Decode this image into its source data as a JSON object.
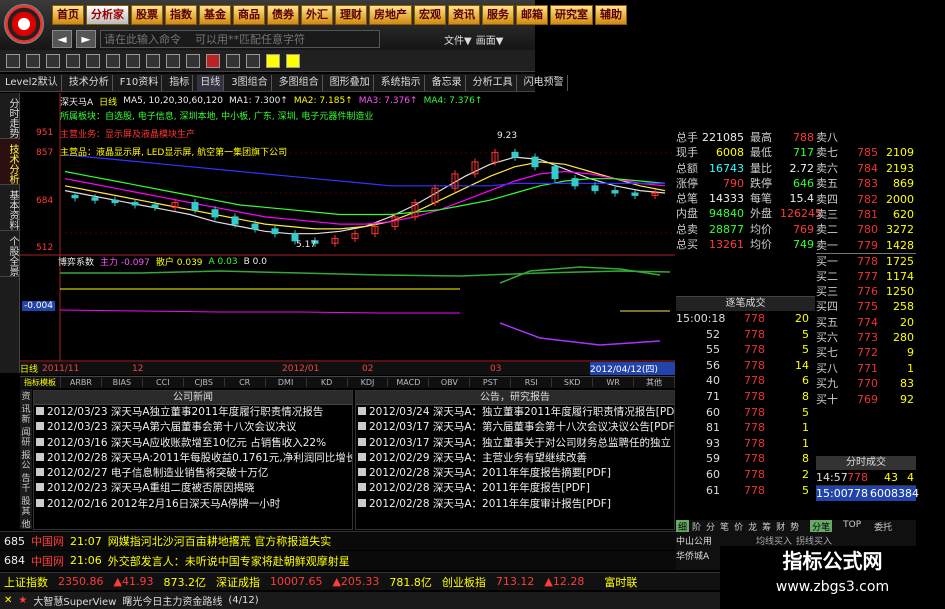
{
  "menu": [
    "首页",
    "分析家",
    "股票",
    "指数",
    "基金",
    "商品",
    "债券",
    "外汇",
    "理财",
    "房地产",
    "宏观",
    "资讯",
    "服务",
    "邮箱",
    "研究室",
    "辅助"
  ],
  "cmd": {
    "placeholder": "请在此输入命令    可以用**匹配任意字符",
    "file": "文件▼",
    "view": "画面▼"
  },
  "toolbar2": [
    "Level2默认",
    "技术分析",
    "F10资料",
    "指标",
    "日线",
    "3图组合",
    "多图组合",
    "图形叠加",
    "系统指示",
    "备忘录",
    "分析工具",
    "闪电预警"
  ],
  "vtabs": [
    "分时走势",
    "技术分析",
    "基本资料",
    "个股全景"
  ],
  "chart": {
    "stock": "深天马A",
    "period": "日线",
    "ma_line": "MA5, 10,20,30,60,120",
    "ma1": "MA1: 7.300↑",
    "ma2": "MA2: 7.185↑",
    "ma3": "MA3: 7.376↑",
    "ma4": "MA4: 7.376↑",
    "price_labels": [
      "951",
      "857",
      "684",
      "512"
    ],
    "notes": [
      {
        "label": "所属板块：自选股, 电子信息, 深圳本地, 中小板, 广东, 深圳, 电子元器件制造业",
        "color": "#3f3"
      },
      {
        "label": "主营业务：显示屏及液晶模块生产",
        "color": "#f33"
      },
      {
        "label": "主营品：液晶显示屏, LED显示屏, 航空第一集团旗下公司",
        "color": "#ff0"
      }
    ],
    "peak_label": "9.23",
    "low_label": "5.17",
    "indicator": {
      "name": "博弈系数",
      "main": "主力 -0.097",
      "retail": "散户 0.039",
      "a": "A 0.03",
      "b": "B 0.0"
    },
    "indicator_value": "-0.004",
    "x_labels": [
      "2011/11",
      "12",
      "2012/01",
      "02",
      "03",
      "2012/04/12(四)"
    ],
    "period_tab": "日线"
  },
  "chart_data": {
    "type": "candlestick",
    "title": "深天马A",
    "x": [
      "2011/11",
      "12",
      "2012/01",
      "02",
      "03",
      "2012/04"
    ],
    "ylim": [
      5.0,
      9.6
    ],
    "closes": [
      7.1,
      7.0,
      6.9,
      6.8,
      6.7,
      6.9,
      6.6,
      6.3,
      6.0,
      5.8,
      5.6,
      5.3,
      5.2,
      5.4,
      5.6,
      5.9,
      6.3,
      6.9,
      7.5,
      8.1,
      8.6,
      9.0,
      8.8,
      8.4,
      7.9,
      7.6,
      7.4,
      7.3,
      7.2,
      7.3
    ],
    "ma_series": [
      {
        "name": "MA1",
        "color": "#e0e0e0",
        "values": [
          7.4,
          7.2,
          7.0,
          6.8,
          6.6,
          6.4,
          6.1,
          5.9,
          5.7,
          5.6,
          5.6,
          5.7,
          5.9,
          6.3,
          6.8,
          7.4,
          8.0,
          8.5,
          8.8,
          8.7,
          8.3,
          7.9,
          7.6,
          7.4,
          7.3
        ]
      },
      {
        "name": "MA2",
        "color": "#ffea3a",
        "values": [
          7.6,
          7.4,
          7.2,
          7.0,
          6.8,
          6.6,
          6.4,
          6.2,
          6.0,
          5.9,
          5.8,
          5.8,
          5.9,
          6.1,
          6.5,
          7.0,
          7.5,
          8.0,
          8.4,
          8.6,
          8.5,
          8.2,
          7.9,
          7.6,
          7.4
        ]
      },
      {
        "name": "MA3",
        "color": "#f0f",
        "values": [
          7.9,
          7.7,
          7.5,
          7.3,
          7.1,
          6.9,
          6.7,
          6.5,
          6.3,
          6.2,
          6.1,
          6.0,
          6.0,
          6.1,
          6.3,
          6.6,
          7.0,
          7.4,
          7.8,
          8.1,
          8.2,
          8.1,
          7.9,
          7.7,
          7.6
        ]
      },
      {
        "name": "MA4",
        "color": "#3f3",
        "values": [
          8.2,
          8.0,
          7.8,
          7.6,
          7.4,
          7.2,
          7.0,
          6.8,
          6.7,
          6.6,
          6.5,
          6.4,
          6.4,
          6.4,
          6.5,
          6.6,
          6.8,
          7.0,
          7.3,
          7.6,
          7.8,
          7.9,
          7.9,
          7.8,
          7.7
        ]
      },
      {
        "name": "MA5",
        "color": "#33f",
        "values": [
          8.9,
          8.8,
          8.7,
          8.6,
          8.5,
          8.4,
          8.3,
          8.2,
          8.1,
          8.0,
          7.9,
          7.8,
          7.7,
          7.6,
          7.6,
          7.6,
          7.6,
          7.6,
          7.7,
          7.7,
          7.7,
          7.7,
          7.7,
          7.7,
          7.7
        ]
      }
    ]
  },
  "indicator_tabs": [
    "指标模板",
    "ARBR",
    "BIAS",
    "CCI",
    "CJBS",
    "CR",
    "DMI",
    "KD",
    "KDJ",
    "MACD",
    "OBV",
    "PST",
    "RSI",
    "SKD",
    "WR",
    "其他"
  ],
  "news_vtabs": [
    "资讯",
    "新闻",
    "研报",
    "公告",
    "千股",
    "其他"
  ],
  "news_left": {
    "title": "公司新闻",
    "rows": [
      "2012/03/23  深天马A独立董事2011年度履行职责情况报告",
      "2012/03/23  深天马A第六届董事会第十八次会议决议",
      "2012/03/16  深天马A应收账款增至10亿元 占销售收入22%",
      "2012/02/28  深天马A:2011年每股收益0.1761元,净利润同比增长43.",
      "2012/02/27  电子信息制造业销售将突破十万亿",
      "2012/02/23  深天马A重组二度被否原因揭晓",
      "2012/02/16  2012年2月16日深天马A停牌一小时"
    ]
  },
  "news_right": {
    "title": "公告，研究报告",
    "rows": [
      "2012/03/24  深天马A：独立董事2011年度履行职责情况报告[PDF]",
      "2012/03/17  深天马A：第六届董事会第十八次会议决议公告[PDF]",
      "2012/03/17  深天马A：独立董事关于对公司财务总监聘任的独立",
      "2012/02/29  深天马A：主营业务有望继续改善",
      "2012/02/28  深天马A：2011年年度报告摘要[PDF]",
      "2012/02/28  深天马A：2011年年度报告[PDF]",
      "2012/02/28  深天马A：2011年年度审计报告[PDF]"
    ]
  },
  "quote": [
    {
      "l1": "总手",
      "v1": "221085",
      "c1": "wht",
      "l2": "最高",
      "v2": "788",
      "c2": "red"
    },
    {
      "l1": "现手",
      "v1": "6008",
      "c1": "yel",
      "l2": "最低",
      "v2": "717",
      "c2": "grn"
    },
    {
      "l1": "总额",
      "v1": "16743",
      "c1": "cyn",
      "l2": "量比",
      "v2": "2.72",
      "c2": "wht"
    },
    {
      "l1": "涨停",
      "v1": "790",
      "c1": "red",
      "l2": "跌停",
      "v2": "646",
      "c2": "grn"
    },
    {
      "l1": "总笔",
      "v1": "14333",
      "c1": "wht",
      "l2": "每笔",
      "v2": "15.4",
      "c2": "wht"
    },
    {
      "l1": "内盘",
      "v1": "94840",
      "c1": "grn",
      "l2": "外盘",
      "v2": "126245",
      "c2": "red"
    },
    {
      "l1": "总卖",
      "v1": "28877",
      "c1": "grn",
      "l2": "均价",
      "v2": "769",
      "c2": "red"
    },
    {
      "l1": "总买",
      "v1": "13261",
      "c1": "red",
      "l2": "均价",
      "v2": "749",
      "c2": "grn"
    }
  ],
  "orders": [
    {
      "l": "卖八",
      "p": "",
      "q": ""
    },
    {
      "l": "卖七",
      "p": "785",
      "q": "2109"
    },
    {
      "l": "卖六",
      "p": "784",
      "q": "2193"
    },
    {
      "l": "卖五",
      "p": "783",
      "q": "869"
    },
    {
      "l": "卖四",
      "p": "782",
      "q": "2000"
    },
    {
      "l": "卖三",
      "p": "781",
      "q": "620"
    },
    {
      "l": "卖二",
      "p": "780",
      "q": "3272"
    },
    {
      "l": "卖一",
      "p": "779",
      "q": "1428"
    },
    {
      "l": "买一",
      "p": "778",
      "q": "1725"
    },
    {
      "l": "买二",
      "p": "777",
      "q": "1174"
    },
    {
      "l": "买三",
      "p": "776",
      "q": "1250"
    },
    {
      "l": "买四",
      "p": "775",
      "q": "258"
    },
    {
      "l": "买五",
      "p": "774",
      "q": "20"
    },
    {
      "l": "买六",
      "p": "773",
      "q": "280"
    },
    {
      "l": "买七",
      "p": "772",
      "q": "9"
    },
    {
      "l": "买八",
      "p": "771",
      "q": "1"
    },
    {
      "l": "买九",
      "p": "770",
      "q": "83"
    },
    {
      "l": "买十",
      "p": "769",
      "q": "92"
    }
  ],
  "ticks": {
    "title": "逐笔成交",
    "rows": [
      {
        "t": "15:00:18",
        "p": "778",
        "v": "20"
      },
      {
        "t": "52",
        "p": "778",
        "v": "5"
      },
      {
        "t": "55",
        "p": "778",
        "v": "5"
      },
      {
        "t": "56",
        "p": "778",
        "v": "14"
      },
      {
        "t": "40",
        "p": "778",
        "v": "6"
      },
      {
        "t": "71",
        "p": "778",
        "v": "8"
      },
      {
        "t": "60",
        "p": "778",
        "v": "5"
      },
      {
        "t": "81",
        "p": "778",
        "v": "1"
      },
      {
        "t": "93",
        "p": "778",
        "v": "1"
      },
      {
        "t": "59",
        "p": "778",
        "v": "8"
      },
      {
        "t": "60",
        "p": "778",
        "v": "2"
      },
      {
        "t": "61",
        "p": "778",
        "v": "5"
      }
    ]
  },
  "fenshi": {
    "title": "分时成交",
    "r1": {
      "t": "14:57",
      "p": "778",
      "a": "43",
      "b": "4"
    },
    "r2": {
      "t": "15:00",
      "p": "778",
      "a": "6008",
      "b": "384"
    }
  },
  "rbot_tabs": [
    "细",
    "阶",
    "分",
    "笔",
    "价",
    "龙",
    "筹",
    "财",
    "势"
  ],
  "rbot_tabs2": [
    "分笔",
    "TOP",
    "委托"
  ],
  "rbot": {
    "l1": "中山公用",
    "l2": "华侨城A",
    "l3": "均线买入",
    "l4": "拐线买入"
  },
  "bar1": {
    "code": "685",
    "name": "中国网",
    "time": "21:07",
    "text": "网媒指河北沙河百亩耕地撂荒 官方称报道失实"
  },
  "bar2": {
    "code": "684",
    "name": "中国网",
    "time": "21:06",
    "text": "外交部发言人：未听说中国专家将赴朝鲜观摩射星"
  },
  "bar3": [
    {
      "n": "上证指数",
      "v": "2350.86",
      "c": "▲41.93",
      "a": "873.2亿"
    },
    {
      "n": "深证成指",
      "v": "10007.65",
      "c": "▲205.33",
      "a": "781.8亿"
    },
    {
      "n": "创业板指",
      "v": "713.12",
      "c": "▲12.28",
      "a": ""
    },
    {
      "n": "富时联",
      "v": "",
      "c": "",
      "a": ""
    }
  ],
  "bar4": {
    "brand": "大智慧SuperView",
    "text": "曙光今日主力资金路线",
    "page": "(4/12)"
  },
  "watermark": {
    "cn": "指标公式网",
    "url": "www.zbgs3.com"
  }
}
